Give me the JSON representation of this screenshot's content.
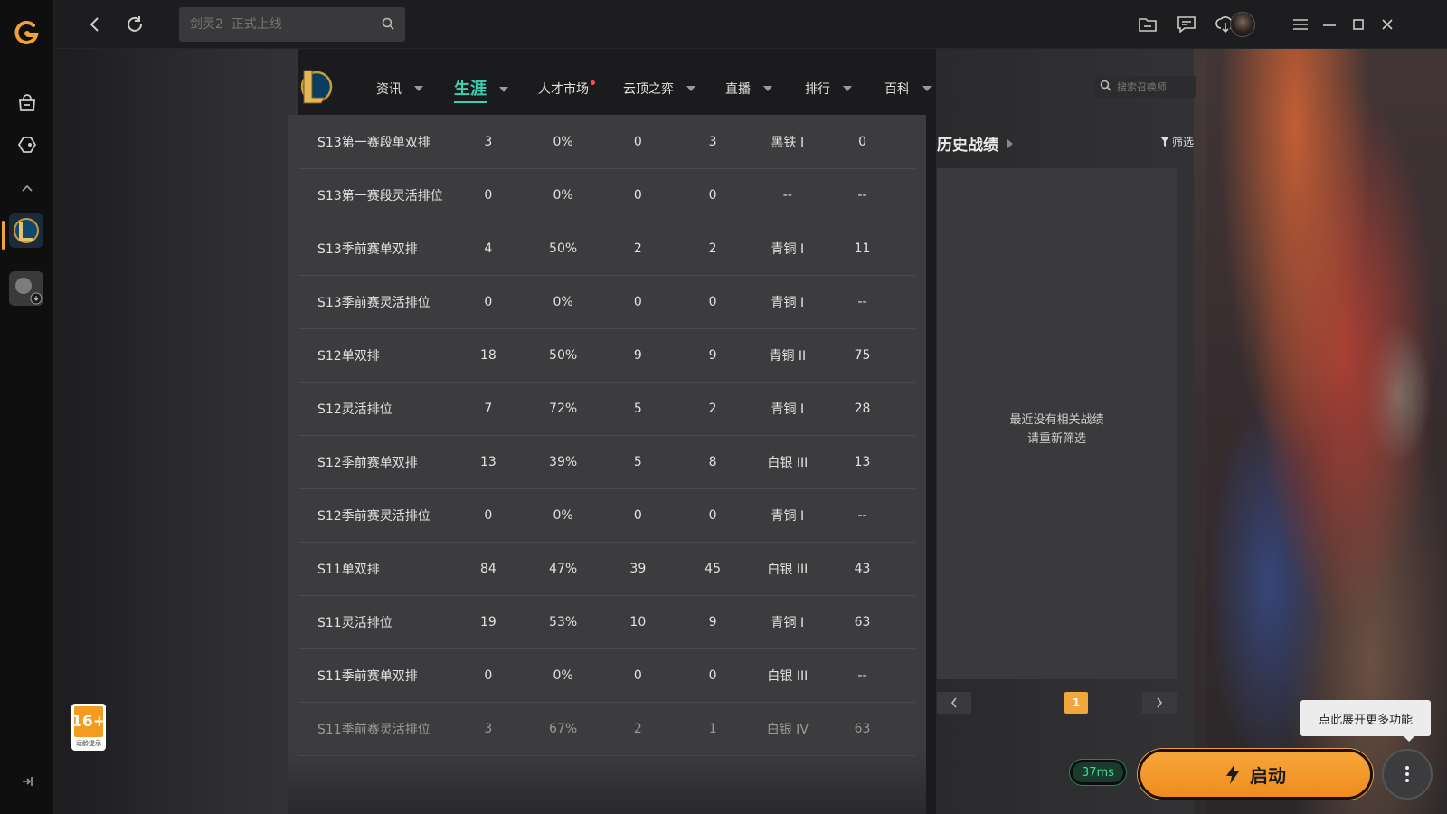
{
  "topbar": {
    "search_placeholder": "剑灵2  正式上线"
  },
  "nav": {
    "items": [
      {
        "label": "资讯"
      },
      {
        "label": "生涯"
      },
      {
        "label": "人才市场"
      },
      {
        "label": "云顶之弈"
      },
      {
        "label": "直播"
      },
      {
        "label": "排行"
      },
      {
        "label": "百科"
      }
    ],
    "search_placeholder": "搜索召唤师"
  },
  "table": {
    "rows": [
      {
        "name": "S13第一赛段单双排",
        "c1": "3",
        "c2": "0%",
        "c3": "0",
        "c4": "3",
        "c5": "黑铁 I",
        "c6": "0"
      },
      {
        "name": "S13第一赛段灵活排位",
        "c1": "0",
        "c2": "0%",
        "c3": "0",
        "c4": "0",
        "c5": "--",
        "c6": "--"
      },
      {
        "name": "S13季前赛单双排",
        "c1": "4",
        "c2": "50%",
        "c3": "2",
        "c4": "2",
        "c5": "青铜 I",
        "c6": "11"
      },
      {
        "name": "S13季前赛灵活排位",
        "c1": "0",
        "c2": "0%",
        "c3": "0",
        "c4": "0",
        "c5": "青铜 I",
        "c6": "--"
      },
      {
        "name": "S12单双排",
        "c1": "18",
        "c2": "50%",
        "c3": "9",
        "c4": "9",
        "c5": "青铜 II",
        "c6": "75"
      },
      {
        "name": "S12灵活排位",
        "c1": "7",
        "c2": "72%",
        "c3": "5",
        "c4": "2",
        "c5": "青铜 I",
        "c6": "28"
      },
      {
        "name": "S12季前赛单双排",
        "c1": "13",
        "c2": "39%",
        "c3": "5",
        "c4": "8",
        "c5": "白银 III",
        "c6": "13"
      },
      {
        "name": "S12季前赛灵活排位",
        "c1": "0",
        "c2": "0%",
        "c3": "0",
        "c4": "0",
        "c5": "青铜 I",
        "c6": "--"
      },
      {
        "name": "S11单双排",
        "c1": "84",
        "c2": "47%",
        "c3": "39",
        "c4": "45",
        "c5": "白银 III",
        "c6": "43"
      },
      {
        "name": "S11灵活排位",
        "c1": "19",
        "c2": "53%",
        "c3": "10",
        "c4": "9",
        "c5": "青铜 I",
        "c6": "63"
      },
      {
        "name": "S11季前赛单双排",
        "c1": "0",
        "c2": "0%",
        "c3": "0",
        "c4": "0",
        "c5": "白银 III",
        "c6": "--"
      },
      {
        "name": "S11季前赛灵活排位",
        "c1": "3",
        "c2": "67%",
        "c3": "2",
        "c4": "1",
        "c5": "白银 IV",
        "c6": "63"
      }
    ]
  },
  "history": {
    "title": "历史战绩",
    "filter_label": "筛选",
    "empty_line1": "最近没有相关战绩",
    "empty_line2": "请重新筛选",
    "current_page": "1"
  },
  "age_badge": {
    "rating": "16+",
    "caption": "适龄提示"
  },
  "launcher": {
    "ping": "37ms",
    "launch_label": "启动",
    "tooltip": "点此展开更多功能"
  },
  "colors": {
    "accent": "#3ecfb1",
    "launch": "#f6a63b",
    "badge": "#f39c1f"
  }
}
